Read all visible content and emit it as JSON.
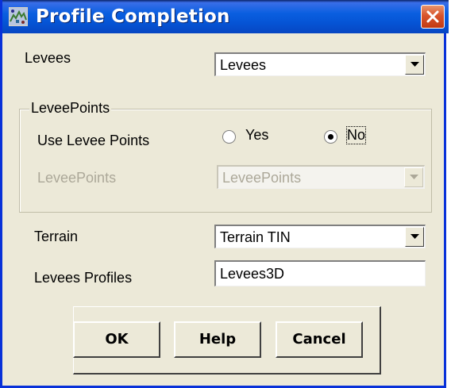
{
  "window": {
    "title": "Profile Completion",
    "icon": "profile-app-icon"
  },
  "fields": {
    "levees": {
      "label": "Levees",
      "value": "Levees"
    },
    "levee_points_group": {
      "legend": "LeveePoints",
      "use_label": "Use Levee Points",
      "options": [
        "Yes",
        "No"
      ],
      "selected": "No",
      "points_label": "LeveePoints",
      "points_value": "LeveePoints"
    },
    "terrain": {
      "label": "Terrain",
      "value": "Terrain TIN"
    },
    "profiles": {
      "label": "Levees Profiles",
      "value": "Levees3D"
    }
  },
  "buttons": {
    "ok": "OK",
    "help": "Help",
    "cancel": "Cancel"
  },
  "colors": {
    "titlebar": "#0553d4",
    "dialog_bg": "#ece9d8",
    "close_red": "#d8542c",
    "disabled_text": "#aca899"
  }
}
